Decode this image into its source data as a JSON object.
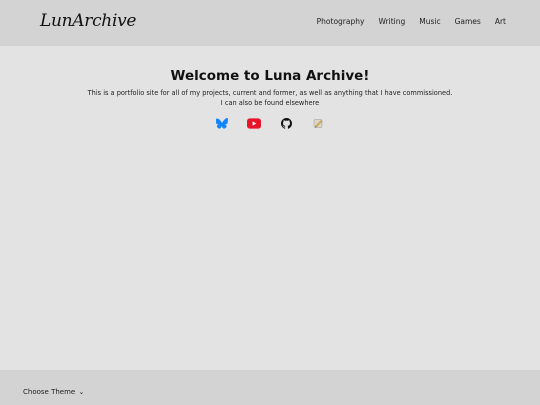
{
  "header": {
    "logo_text": "LunArchive",
    "nav": [
      {
        "label": "Photography"
      },
      {
        "label": "Writing"
      },
      {
        "label": "Music"
      },
      {
        "label": "Games"
      },
      {
        "label": "Art"
      }
    ]
  },
  "main": {
    "title": "Welcome to Luna Archive!",
    "description": "This is a portfolio site for all of my projects, current and former, as well as anything that I have commissioned.",
    "elsewhere": "I can also be found elsewhere",
    "social_icons": [
      "bluesky-icon",
      "youtube-icon",
      "github-icon",
      "pencil-icon"
    ]
  },
  "footer": {
    "theme_label": "Choose Theme",
    "theme_chevron": "⌄"
  },
  "colors": {
    "header_bg": "#d3d3d3",
    "body_bg": "#e3e3e3",
    "bluesky": "#1185fe",
    "youtube": "#e8152a"
  }
}
